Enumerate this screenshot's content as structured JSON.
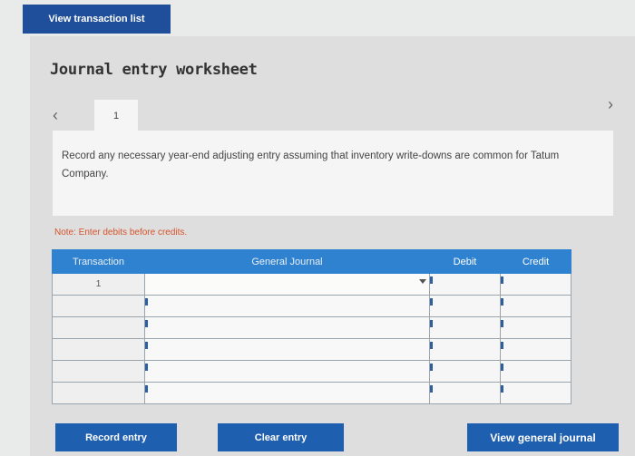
{
  "top": {
    "view_transaction_list": "View transaction list"
  },
  "worksheet": {
    "title": "Journal entry worksheet",
    "tabs": [
      {
        "label": "1"
      }
    ],
    "instruction": "Record any necessary year-end adjusting entry assuming that inventory write-downs are common for Tatum Company.",
    "note": "Note: Enter debits before credits."
  },
  "icons": {
    "prev": "chevron-left-icon",
    "next": "chevron-right-icon",
    "dropdown": "dropdown-arrow-icon"
  },
  "table": {
    "headers": {
      "transaction": "Transaction",
      "general_journal": "General Journal",
      "debit": "Debit",
      "credit": "Credit"
    },
    "rows": [
      {
        "transaction": "1",
        "general_journal": "",
        "debit": "",
        "credit": ""
      },
      {
        "transaction": "",
        "general_journal": "",
        "debit": "",
        "credit": ""
      },
      {
        "transaction": "",
        "general_journal": "",
        "debit": "",
        "credit": ""
      },
      {
        "transaction": "",
        "general_journal": "",
        "debit": "",
        "credit": ""
      },
      {
        "transaction": "",
        "general_journal": "",
        "debit": "",
        "credit": ""
      },
      {
        "transaction": "",
        "general_journal": "",
        "debit": "",
        "credit": ""
      }
    ]
  },
  "buttons": {
    "record_entry": "Record entry",
    "clear_entry": "Clear entry",
    "view_general_journal": "View general journal"
  },
  "colors": {
    "header_blue": "#2f82cf",
    "button_blue": "#1f5faf",
    "note_orange": "#d8532b"
  }
}
